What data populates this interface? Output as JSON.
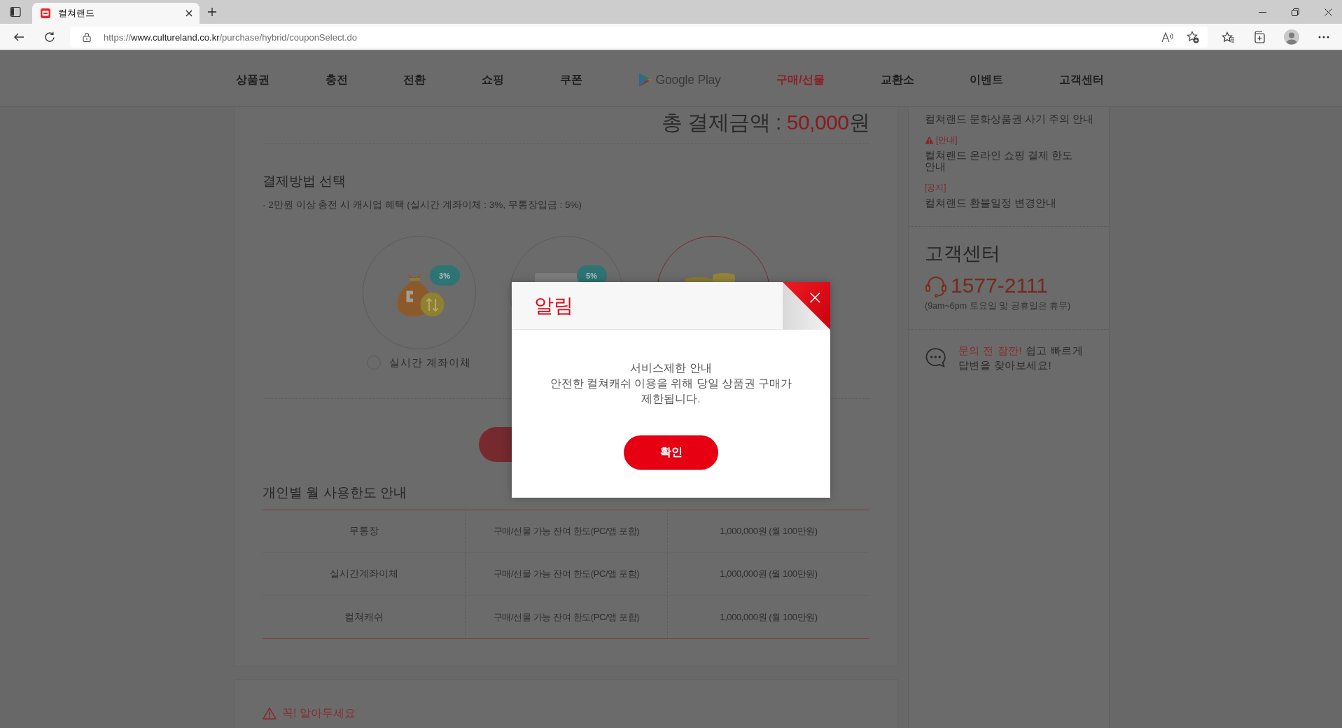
{
  "browser": {
    "tabs": [
      {
        "title": "컬쳐랜드",
        "selected": true
      }
    ],
    "address": {
      "scheme": "https://",
      "host": "www.cultureland.co.kr",
      "path": "/purchase/hybrid/couponSelect.do"
    }
  },
  "nav": {
    "items": [
      {
        "kind": "text",
        "label": "상품권",
        "selected": false
      },
      {
        "kind": "text",
        "label": "충전",
        "selected": false
      },
      {
        "kind": "text",
        "label": "전환",
        "selected": false
      },
      {
        "kind": "text",
        "label": "쇼핑",
        "selected": false
      },
      {
        "kind": "text",
        "label": "쿠폰",
        "selected": false
      },
      {
        "kind": "logo",
        "label": "Google Play",
        "selected": false
      },
      {
        "kind": "text",
        "label": "구매/선물",
        "selected": true
      },
      {
        "kind": "text",
        "label": "교환소",
        "selected": false
      },
      {
        "kind": "text",
        "label": "이벤트",
        "selected": false
      },
      {
        "kind": "text",
        "label": "고객센터",
        "selected": false
      }
    ]
  },
  "payment": {
    "total": {
      "label": "총 결제금액 :",
      "amount": "50,000",
      "unit": "원"
    },
    "title": "결제방법 선택",
    "note": "· 2만원 이상 충전 시 캐시업 혜택 (실시간 계좌이체 : 3%, 무통장입금 : 5%)",
    "methods": [
      {
        "kind": "transfer",
        "badge": "3%",
        "label": "실시간 계좌이체",
        "selected": false
      },
      {
        "kind": "deposit",
        "badge": "5%",
        "selected": false
      },
      {
        "kind": "cash",
        "selected": true
      }
    ]
  },
  "limits": {
    "title": "개인별 월 사용한도 안내",
    "rows": [
      [
        "무통장",
        "구매/선물 가능 잔여 한도(PC/앱 포함)",
        "1,000,000원 (월 100만원)"
      ],
      [
        "실시간계좌이체",
        "구매/선물 가능 잔여 한도(PC/앱 포함)",
        "1,000,000원 (월 100만원)"
      ],
      [
        "컬쳐캐쉬",
        "구매/선물 가능 잔여 한도(PC/앱 포함)",
        "1,000,000원 (월 100만원)"
      ]
    ]
  },
  "notice": {
    "title": "꼭! 알아두세요"
  },
  "sidebar": {
    "notices": [
      {
        "kind": "plain",
        "title": "컬쳐랜드 문화상품권 사기 주의 안내"
      },
      {
        "kind": "alert",
        "tag": "[안내]",
        "title": "컬쳐랜드 온라인 쇼핑 결제 한도 안내"
      },
      {
        "kind": "plain",
        "tag": "[공지]",
        "title": "컬쳐랜드 환불일정 변경안내"
      }
    ],
    "support": {
      "title": "고객센터",
      "phone": "1577-2111",
      "hours": "(9am~6pm 토요일 및 공휴일은 휴무)"
    },
    "faq": {
      "lead": "문의 전 잠깐!",
      "text": "쉽고 빠르게 답변을 찾아보세요!"
    }
  },
  "dialog": {
    "title": "알림",
    "subtitle": "서비스제한 안내",
    "message": "안전한 컬쳐캐쉬 이용을 위해 당일 상품권 구매가 제한됩니다.",
    "button": "확인"
  }
}
